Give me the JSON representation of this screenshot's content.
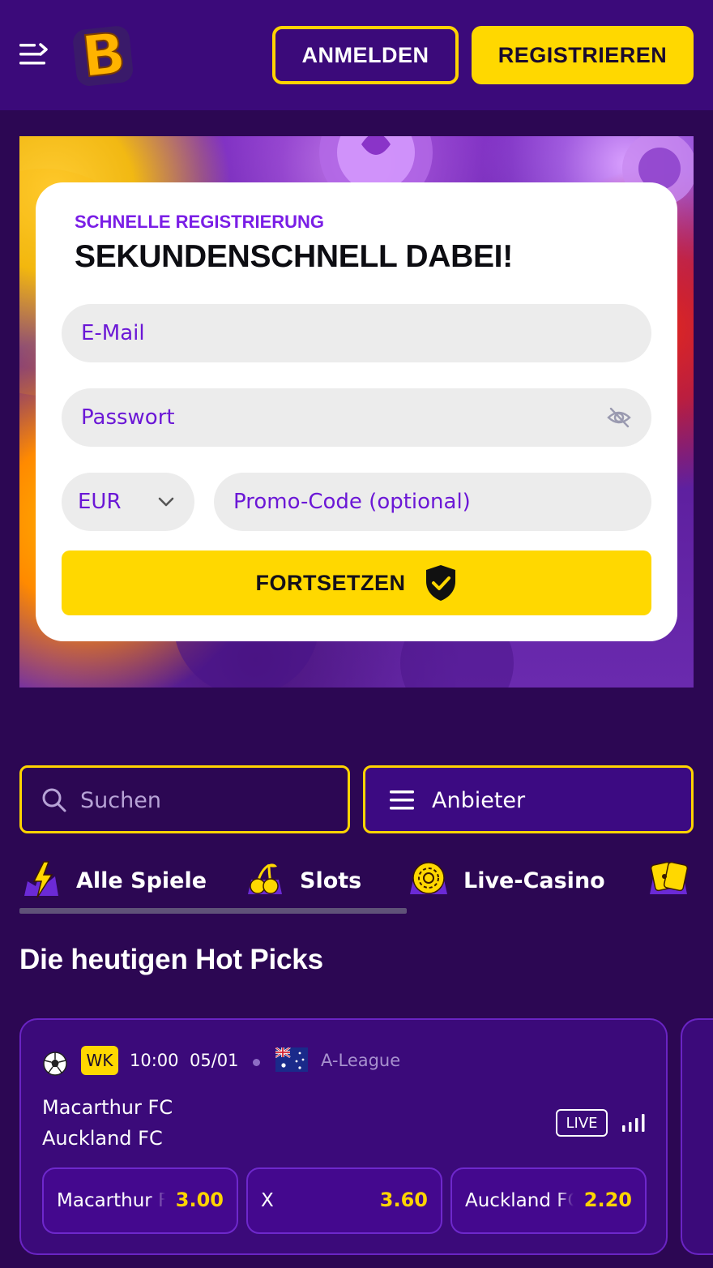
{
  "header": {
    "login_label": "ANMELDEN",
    "register_label": "REGISTRIEREN",
    "logo_letter": "B"
  },
  "registration": {
    "subtitle": "SCHNELLE REGISTRIERUNG",
    "title": "SEKUNDENSCHNELL DABEI!",
    "email_placeholder": "E-Mail",
    "password_placeholder": "Passwort",
    "currency": "EUR",
    "promo_placeholder": "Promo-Code (optional)",
    "continue_label": "FORTSETZEN"
  },
  "search": {
    "placeholder": "Suchen"
  },
  "providers": {
    "label": "Anbieter"
  },
  "tabs": [
    {
      "label": "Alle Spiele",
      "icon": "lightning-icon"
    },
    {
      "label": "Slots",
      "icon": "cherries-icon"
    },
    {
      "label": "Live-Casino",
      "icon": "chip-icon"
    },
    {
      "label": "",
      "icon": "cards-icon"
    }
  ],
  "hot_picks": {
    "title": "Die heutigen Hot Picks",
    "match": {
      "sport_icon": "soccer-ball-icon",
      "badge": "WK",
      "time": "10:00",
      "date": "05/01",
      "country_icon": "australia-flag-icon",
      "league": "A-League",
      "team1": "Macarthur FC",
      "team2": "Auckland FC",
      "live_label": "LIVE",
      "odds": [
        {
          "label": "Macarthur FC",
          "value": "3.00"
        },
        {
          "label": "X",
          "value": "3.60"
        },
        {
          "label": "Auckland FC",
          "value": "2.20"
        }
      ]
    }
  },
  "colors": {
    "background": "#2c0753",
    "header": "#3b0a7a",
    "accent_yellow": "#ffd800",
    "accent_purple": "#7a1ee6"
  }
}
